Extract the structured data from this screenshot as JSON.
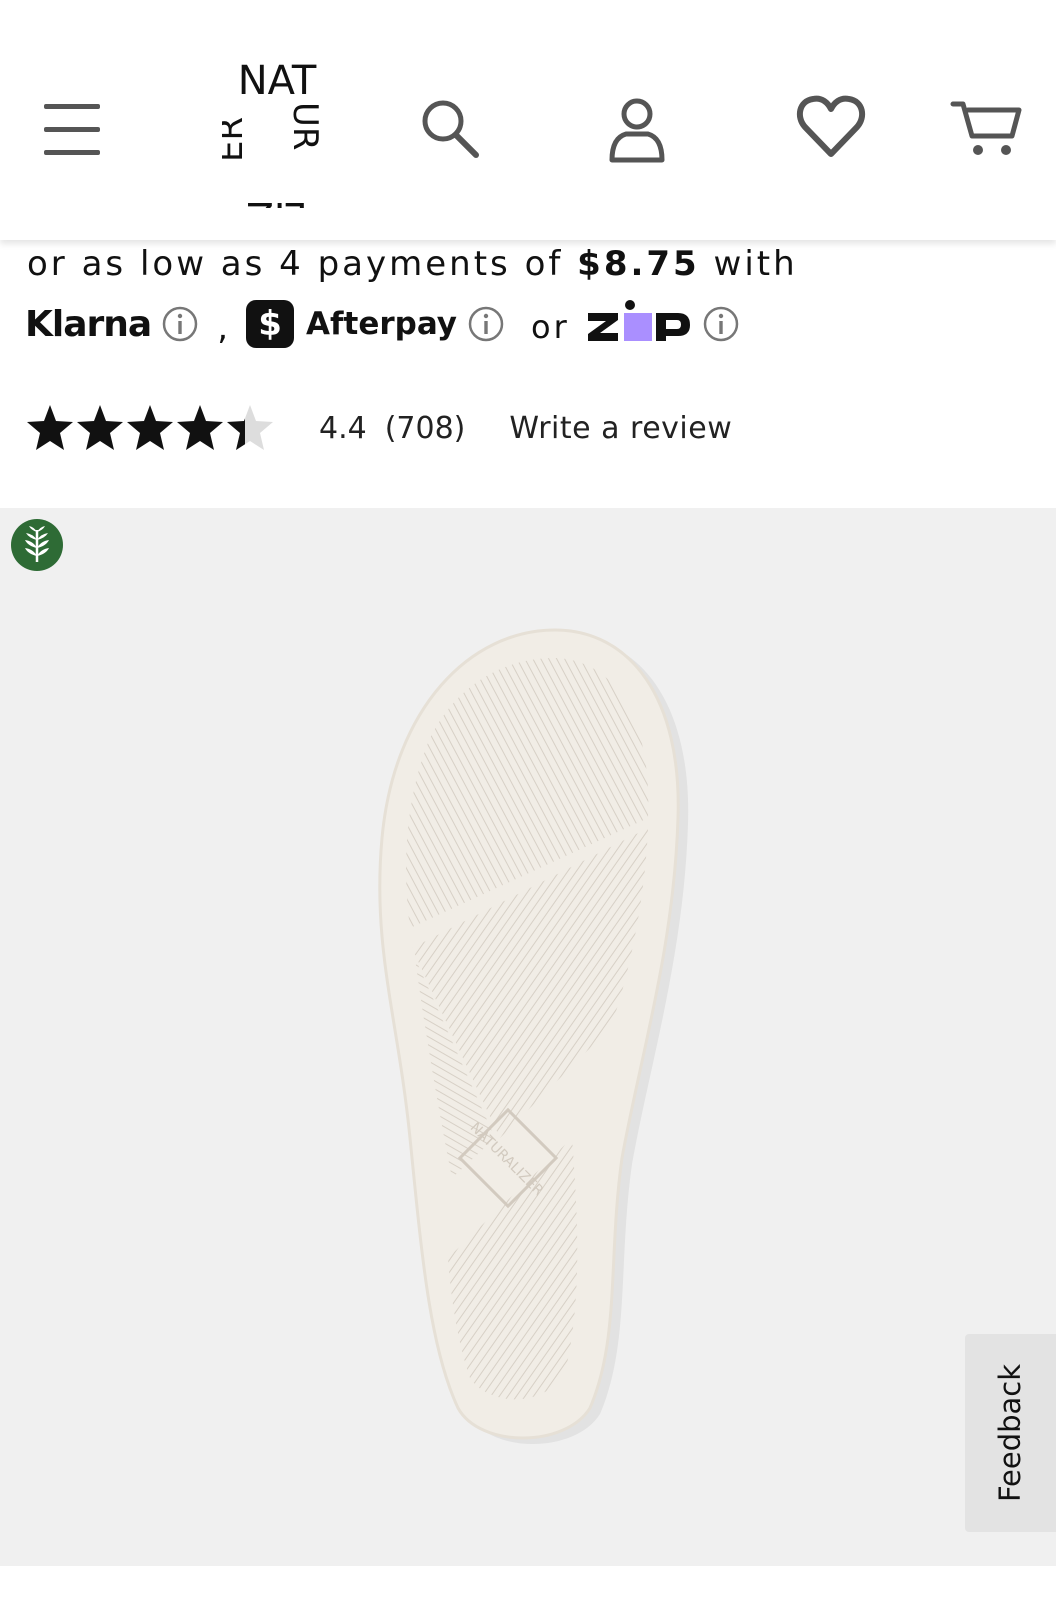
{
  "header": {
    "logo_rows": [
      "NAT",
      "ER",
      "UR",
      "ZI",
      "LA"
    ],
    "icons": [
      "menu-icon",
      "search-icon",
      "account-icon",
      "heart-icon",
      "cart-icon"
    ]
  },
  "payment": {
    "line_prefix": "or as low as 4 payments of ",
    "amount": "$8.75",
    "line_suffix": " with",
    "klarna": "Klarna",
    "separator": ",",
    "afterpay_badge": "$",
    "afterpay": "Afterpay",
    "or": "or",
    "zip": "zip"
  },
  "rating": {
    "stars_value": 4.4,
    "stars_max": 5,
    "value": "4.4",
    "count": "(708)",
    "write_review": "Write a review"
  },
  "product": {
    "sole_logo": "NATURALIZER"
  },
  "feedback": "Feedback",
  "colors": {
    "eco_badge": "#2e6b35",
    "zip_purple": "#aa8fff",
    "image_bg": "#f0f0f0"
  }
}
